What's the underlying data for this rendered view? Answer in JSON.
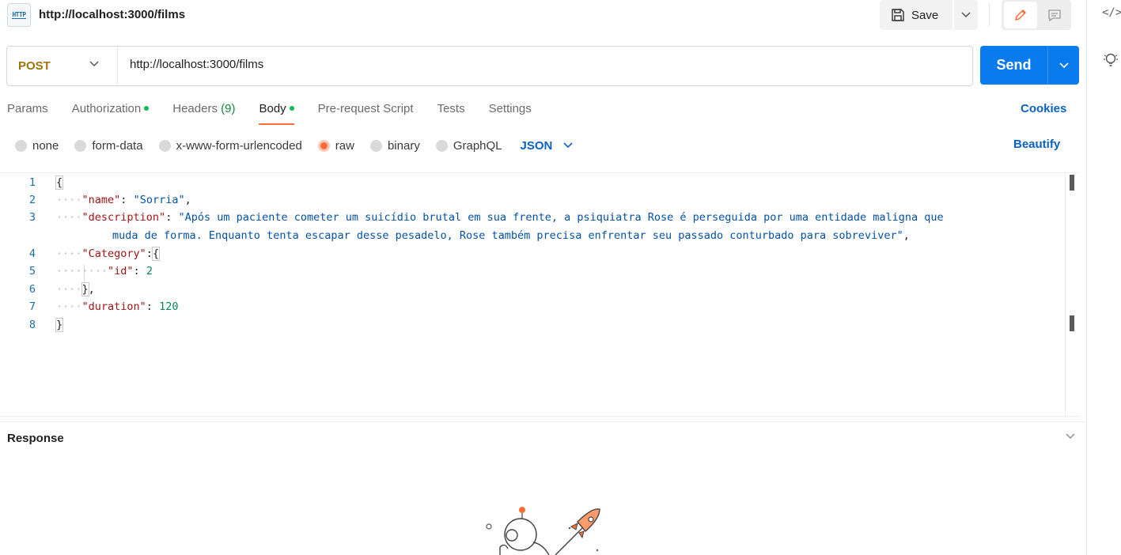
{
  "header": {
    "request_title": "http://localhost:3000/films",
    "save_label": "Save",
    "http_icon_text": "HTTP"
  },
  "request": {
    "method": "POST",
    "url": "http://localhost:3000/films",
    "send_label": "Send"
  },
  "tabs": [
    {
      "label": "Params"
    },
    {
      "label": "Authorization",
      "dot": true
    },
    {
      "label": "Headers",
      "count": "(9)"
    },
    {
      "label": "Body",
      "dot": true,
      "active": true
    },
    {
      "label": "Pre-request Script"
    },
    {
      "label": "Tests"
    },
    {
      "label": "Settings"
    }
  ],
  "cookies_label": "Cookies",
  "body_types": [
    {
      "label": "none"
    },
    {
      "label": "form-data"
    },
    {
      "label": "x-www-form-urlencoded"
    },
    {
      "label": "raw",
      "selected": true
    },
    {
      "label": "binary"
    },
    {
      "label": "GraphQL"
    }
  ],
  "format_select": "JSON",
  "beautify_label": "Beautify",
  "editor": {
    "line_numbers": [
      "1",
      "2",
      "3",
      "4",
      "5",
      "6",
      "7",
      "8"
    ],
    "json_body": {
      "name_key": "\"name\"",
      "name_value": "\"Sorria\"",
      "description_key": "\"description\"",
      "description_value_line1": "\"Após um paciente cometer um suicídio brutal em sua frente, a psiquiatra Rose é perseguida por uma entidade maligna que",
      "description_value_line2": "muda de forma. Enquanto tenta escapar desse pesadelo, Rose também precisa enfrentar seu passado conturbado para sobreviver\"",
      "category_key": "\"Category\"",
      "id_key": "\"id\"",
      "id_value": "2",
      "duration_key": "\"duration\"",
      "duration_value": "120"
    }
  },
  "response": {
    "title": "Response"
  },
  "colors": {
    "send_blue": "#097bed",
    "accent_orange": "#ff6c37",
    "method_post": "#a0740c",
    "link_blue": "#0b62c4",
    "status_dot_green": "#0cbb52"
  }
}
